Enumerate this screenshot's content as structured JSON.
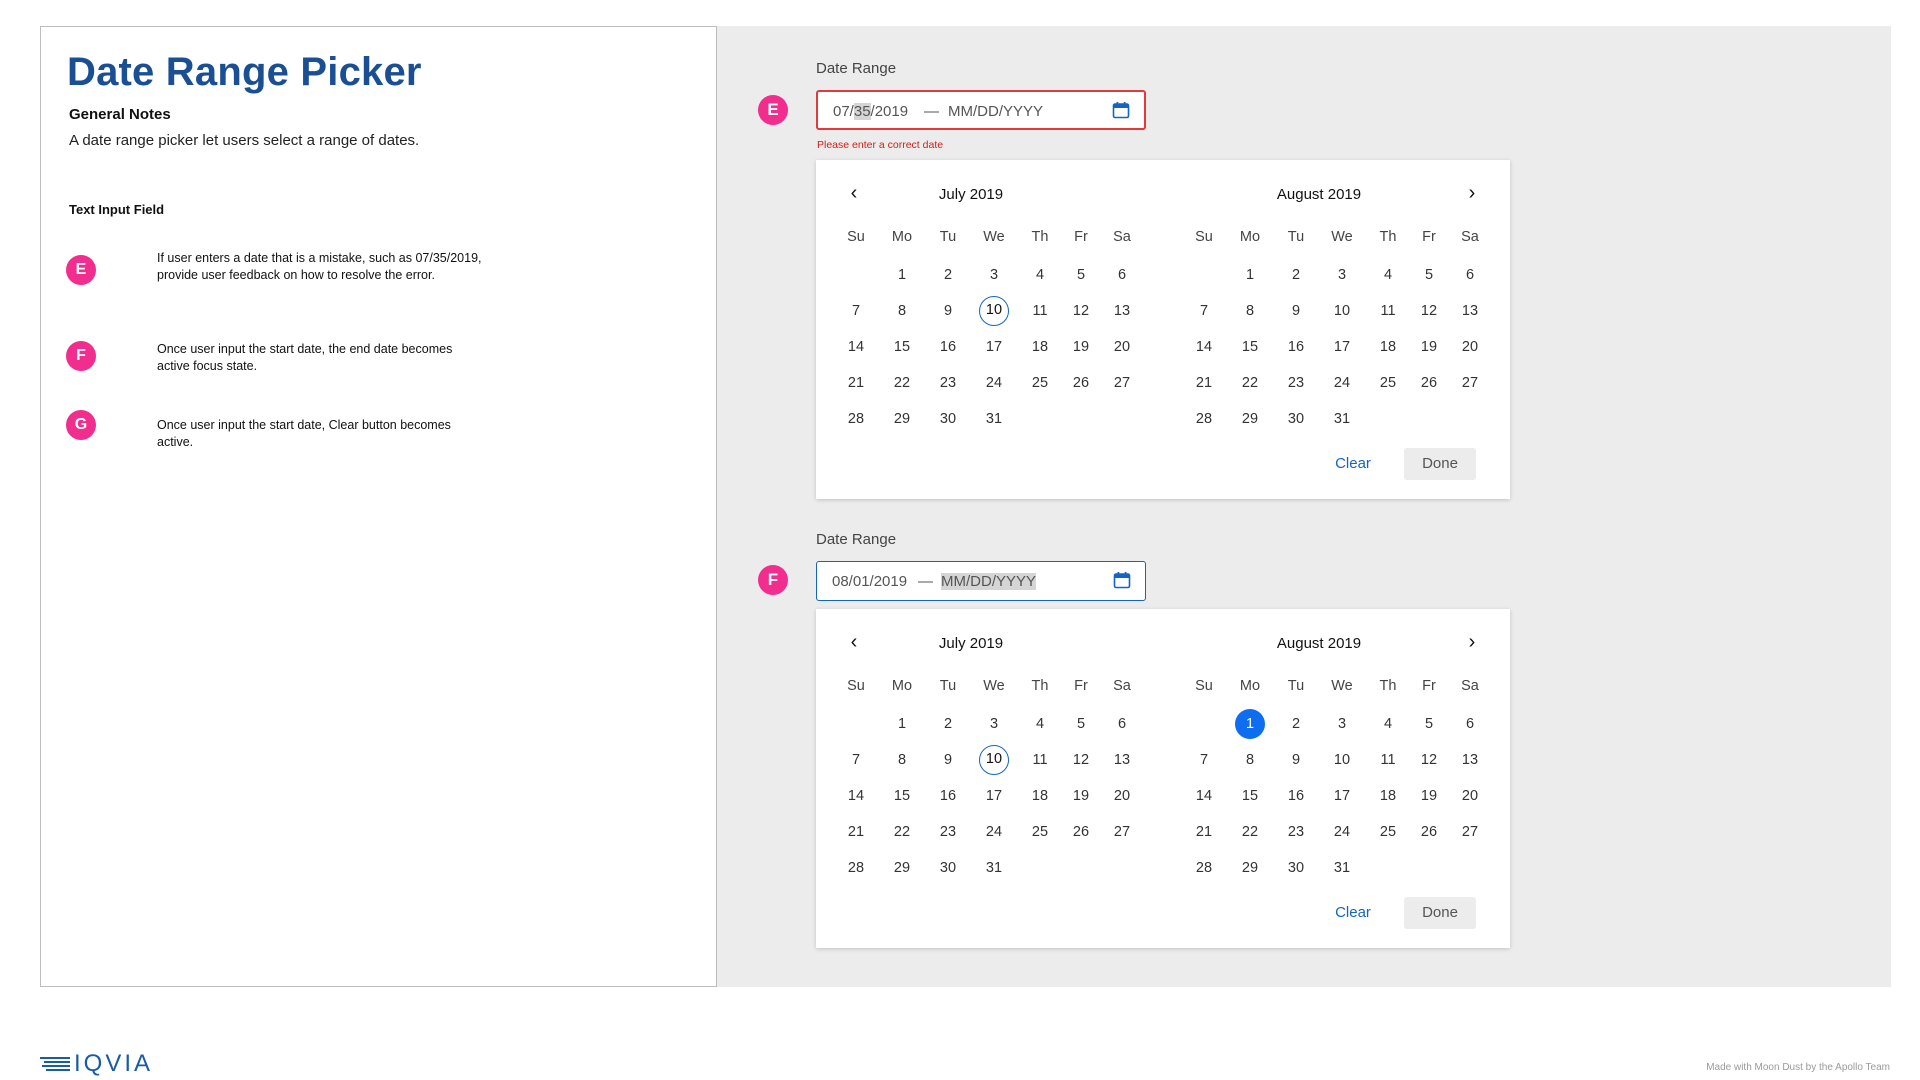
{
  "doc": {
    "title": "Date Range Picker",
    "notes_heading": "General Notes",
    "notes_text": "A date range picker let users select a range of dates.",
    "section_heading": "Text Input Field",
    "notes": [
      {
        "badge": "E",
        "text": "If user enters a date that is a mistake, such as 07/35/2019, provide user feedback on how to resolve the error."
      },
      {
        "badge": "F",
        "text": "Once user input the start date, the end date becomes active focus state."
      },
      {
        "badge": "G",
        "text": "Once user input the start date, Clear button becomes active."
      }
    ]
  },
  "picker_e": {
    "marker": "E",
    "label": "Date Range",
    "start_prefix": "07/",
    "start_highlight": "35",
    "start_suffix": "/2019",
    "separator": "—",
    "end_placeholder": "MM/DD/YYYY",
    "error": "Please enter a correct date"
  },
  "picker_f": {
    "marker": "F",
    "label": "Date Range",
    "start_value": "08/01/2019",
    "separator": "—",
    "end_placeholder": "MM/DD/YYYY"
  },
  "calendar": {
    "dow": [
      "Su",
      "Mo",
      "Tu",
      "We",
      "Th",
      "Fr",
      "Sa"
    ],
    "months": [
      {
        "title": "July 2019",
        "first_dow": 1,
        "days": 31,
        "today": 10
      },
      {
        "title": "August 2019",
        "first_dow": 1,
        "days": 31
      }
    ],
    "clear_label": "Clear",
    "done_label": "Done"
  },
  "picker_f_selected": {
    "month_index": 1,
    "day": 1
  },
  "footer": {
    "logo": "IQVIA",
    "credit": "Made with Moon Dust by the Apollo Team"
  },
  "colors": {
    "accent_pink": "#f12d8e",
    "title_blue": "#1a4f94",
    "link_blue": "#1565c0",
    "error_red": "#e23a3a",
    "selected_blue": "#0f6ef0"
  }
}
